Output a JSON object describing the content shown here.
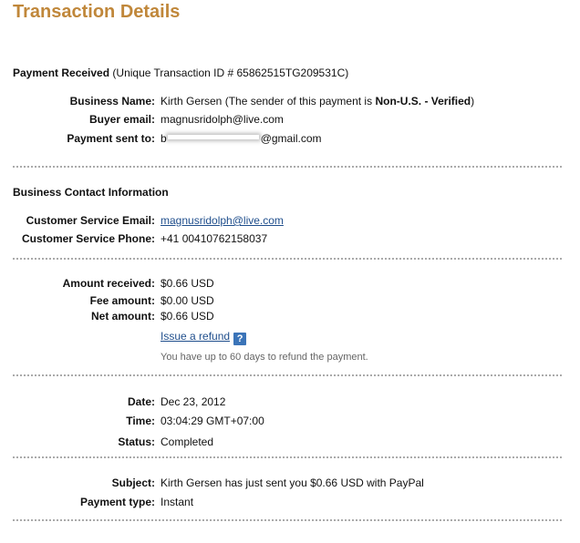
{
  "title": "Transaction Details",
  "payment_received": {
    "heading": "Payment Received",
    "txn_note": "(Unique Transaction ID # 65862515TG209531C)",
    "business_name_label": "Business Name:",
    "business_name_value": "Kirth Gersen (The sender of this payment is",
    "business_status": "Non-U.S. - Verified",
    "business_status_close": ")",
    "buyer_email_label": "Buyer email:",
    "buyer_email_value": "magnusridolph@live.com",
    "payment_sent_to_label": "Payment sent to:",
    "payment_sent_to_prefix": "b",
    "payment_sent_to_suffix": "@gmail.com"
  },
  "business_contact": {
    "heading": "Business Contact Information",
    "cs_email_label": "Customer Service Email:",
    "cs_email_value": "magnusridolph@live.com",
    "cs_phone_label": "Customer Service Phone:",
    "cs_phone_value": "+41 00410762158037"
  },
  "amounts": {
    "received_label": "Amount received:",
    "received_value": "$0.66 USD",
    "fee_label": "Fee amount:",
    "fee_value": "$0.00 USD",
    "net_label": "Net amount:",
    "net_value": "$0.66 USD",
    "refund_link": "Issue a refund",
    "help_icon_glyph": "?",
    "refund_note": "You have up to 60 days to refund the payment."
  },
  "datetime": {
    "date_label": "Date:",
    "date_value": "Dec 23, 2012",
    "time_label": "Time:",
    "time_value": "03:04:29 GMT+07:00",
    "status_label": "Status:",
    "status_value": "Completed"
  },
  "subject": {
    "subject_label": "Subject:",
    "subject_value": "Kirth Gersen has just sent you $0.66 USD with PayPal",
    "payment_type_label": "Payment type:",
    "payment_type_value": "Instant"
  },
  "colors": {
    "title": "#c0873a",
    "link": "#1f4e8c",
    "help_icon": "#3b74b8",
    "divider": "#aaaaaa"
  },
  "icons": {
    "help": "question-mark-icon"
  }
}
